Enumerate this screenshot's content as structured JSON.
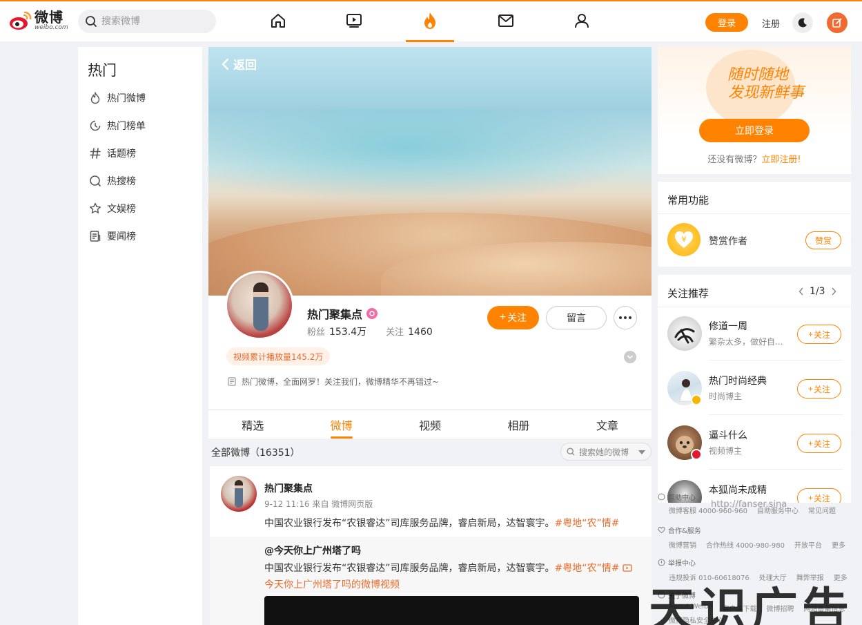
{
  "header": {
    "logo_cn": "微博",
    "logo_en": "weibo.com",
    "search_placeholder": "搜索微博",
    "login": "登录",
    "register": "注册"
  },
  "sidebar": {
    "title": "热门",
    "items": [
      {
        "label": "热门微博",
        "icon": "flame-icon"
      },
      {
        "label": "热门榜单",
        "icon": "clock-icon"
      },
      {
        "label": "话题榜",
        "icon": "hashtag-icon"
      },
      {
        "label": "热搜榜",
        "icon": "search-icon"
      },
      {
        "label": "文娱榜",
        "icon": "star-icon"
      },
      {
        "label": "要闻榜",
        "icon": "news-icon"
      }
    ]
  },
  "profile": {
    "back": "返回",
    "name": "热门聚集点",
    "fans_label": "粉丝",
    "fans": "153.4万",
    "follow_label": "关注",
    "follow": "1460",
    "follow_btn": "关注",
    "message_btn": "留言",
    "play_badge": "视频累计播放量145.2万",
    "bio": "热门微博，全面网罗！关注我们，微博精华不再错过~"
  },
  "tabs": [
    "精选",
    "微博",
    "视频",
    "相册",
    "文章"
  ],
  "active_tab": 1,
  "feed": {
    "all_label": "全部微博（16351）",
    "search_placeholder": "搜索她的微博"
  },
  "post": {
    "author": "热门聚集点",
    "meta": "9-12 11:16 来自 微博网页版",
    "text": "中国农业银行发布“农银睿达”司库服务品牌，睿启新局，达智寰宇。",
    "tag": "#粤地“农”情#",
    "repost_author": "@今天你上广州塔了吗",
    "repost_text": "中国农业银行发布“农银睿达”司库服务品牌，睿启新局，达智寰宇。",
    "repost_tag": "#粤地“农”情#",
    "repost_video_link": "今天你上广州塔了吗的微博视频"
  },
  "right": {
    "slogan_1": "随时随地",
    "slogan_2": "发现新鲜事",
    "quick_login": "立即登录",
    "no_account": "还没有微博？",
    "register_now": "立即注册!",
    "func_title": "常用功能",
    "reward_label": "赞赏作者",
    "reward_btn": "赞赏",
    "rec_title": "关注推荐",
    "pager": "1/3",
    "follow_btn": "关注",
    "recommendations": [
      {
        "name": "修道一周",
        "desc": "繁杂太多，做好自..."
      },
      {
        "name": "热门时尚经典",
        "desc": "时尚博主"
      },
      {
        "name": "逼斗什么",
        "desc": "视频博主"
      },
      {
        "name": "本狐尚未成精",
        "desc": ""
      }
    ]
  },
  "footer": {
    "help_title": "帮助中心",
    "help_links": [
      "微博客服 4000-960-960",
      "自助服务中心",
      "常见问题"
    ],
    "coop_title": "合作&服务",
    "coop_links": [
      "微博营销",
      "合作热线 4000-980-980",
      "开放平台",
      "更多"
    ],
    "report_title": "举报中心",
    "report_links": [
      "违规投诉 010-60618076",
      "处理大厅",
      "舞弊举报",
      "更多"
    ],
    "about_title": "关于微博",
    "about_links": [
      "About Weibo",
      "客户端下载",
      "微博招聘",
      "网站备案信息"
    ],
    "about_links2": [
      "微博隐私安全中心"
    ]
  },
  "watermark": {
    "url": "http://fanser.sina",
    "text": "天识广告"
  }
}
